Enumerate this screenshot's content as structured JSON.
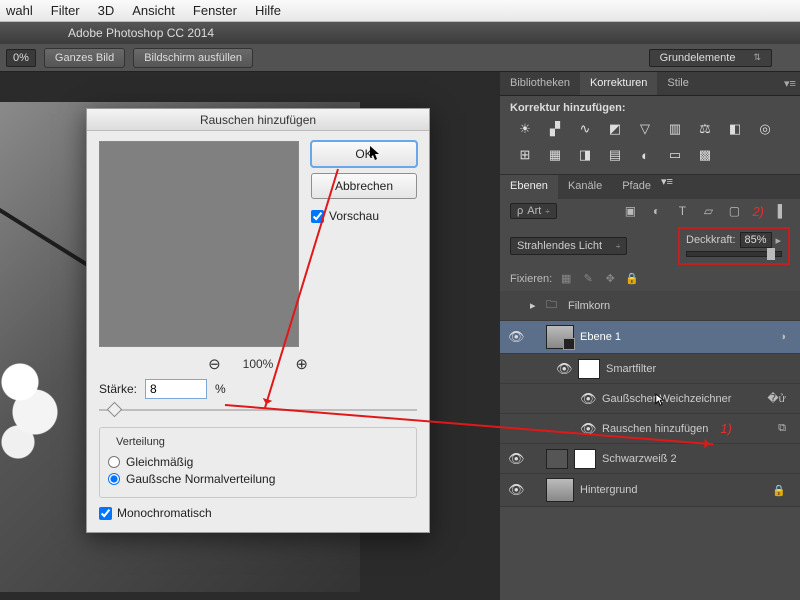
{
  "menubar": [
    "wahl",
    "Filter",
    "3D",
    "Ansicht",
    "Fenster",
    "Hilfe"
  ],
  "app_title": "Adobe Photoshop CC 2014",
  "optionsbar": {
    "zoom": "0%",
    "fit": "Ganzes Bild",
    "fill": "Bildschirm ausfüllen",
    "workspace": "Grundelemente"
  },
  "dialog": {
    "title": "Rauschen hinzufügen",
    "ok": "OK",
    "cancel": "Abbrechen",
    "preview": "Vorschau",
    "zoom_pct": "100%",
    "amount_label": "Stärke:",
    "amount_value": "8",
    "pct": "%",
    "dist_title": "Verteilung",
    "dist_uniform": "Gleichmäßig",
    "dist_gauss": "Gaußsche Normalverteilung",
    "mono": "Monochromatisch"
  },
  "panels": {
    "libs": "Bibliotheken",
    "adjustments": "Korrekturen",
    "styles": "Stile",
    "add_adj": "Korrektur hinzufügen:",
    "layers": "Ebenen",
    "channels": "Kanäle",
    "paths": "Pfade",
    "kind_label": "ρ",
    "kind_value": "Art",
    "blend_mode": "Strahlendes Licht",
    "opacity_label": "Deckkraft:",
    "opacity_value": "85%",
    "lock_label": "Fixieren:"
  },
  "layers": {
    "group": "Filmkorn",
    "l1": "Ebene 1",
    "smart": "Smartfilter",
    "gauss": "Gaußscher Weichzeichner",
    "noise": "Rauschen hinzufügen",
    "bw": "Schwarzweiß 2",
    "bg": "Hintergrund"
  },
  "annotations": {
    "n1": "1)",
    "n2": "2)"
  }
}
